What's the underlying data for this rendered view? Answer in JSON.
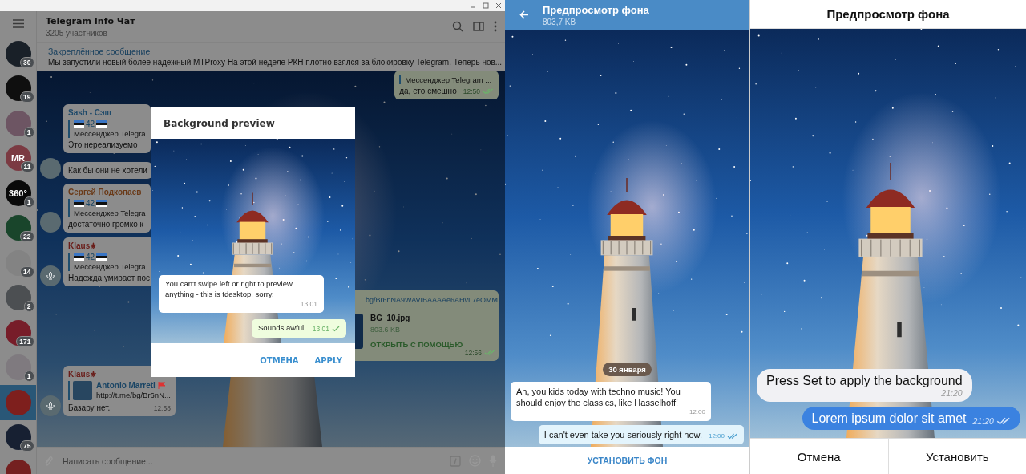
{
  "desktop": {
    "chat_list": [
      {
        "badge": "30",
        "color": "#192028",
        "selected": false
      },
      {
        "badge": "19",
        "color": "#0f0f0f",
        "selected": false
      },
      {
        "badge": "1",
        "color": "#6d5563",
        "selected": false
      },
      {
        "initials": "MR",
        "badge": "11",
        "color": "#7b3a42",
        "selected": false
      },
      {
        "initials": "360°",
        "badge": "1",
        "color": "#090909",
        "selected": false
      },
      {
        "badge": "22",
        "color": "#19452b",
        "selected": false
      },
      {
        "badge": "14",
        "color": "#838383",
        "selected": false
      },
      {
        "badge": "2",
        "color": "#4c4f52",
        "selected": false
      },
      {
        "badge": "171",
        "color": "#771d29",
        "selected": false
      },
      {
        "badge": "1",
        "color": "#7f7a7f",
        "selected": false
      },
      {
        "color": "#7e1f1d",
        "selected": true
      },
      {
        "badge": "75",
        "color": "#172032",
        "selected": false
      },
      {
        "color": "#742020",
        "selected": false
      }
    ],
    "chat_header": {
      "title": "Telegram Info Чат",
      "subtitle": "3205 участников"
    },
    "pinned_message": {
      "label": "Закреплённое сообщение",
      "text": "Мы запустили новый более надёжный MTProxy  На этой неделе РКН плотно взялся за блокировку Telegram. Теперь нов..."
    },
    "messages": [
      {
        "kind": "outgoing",
        "reply_text": "Мессенджер Telegram ...",
        "text": "да, ето смешно",
        "time": "12:50",
        "read": true
      },
      {
        "kind": "incoming",
        "sender": "Sash - Сэш",
        "color": "#1f4a6a",
        "reply_title": "42",
        "reply_text": "Мессенджер Telegra",
        "text": "Это нереализуемо",
        "avatar": false
      },
      {
        "kind": "incoming",
        "text": "Как бы они не хотели",
        "avatar": true
      },
      {
        "kind": "incoming",
        "sender": "Сергей Подкопаев",
        "color": "#6a3a18",
        "reply_title": "42",
        "reply_text": "Мессенджер Telegra",
        "text": "достаточно громко к",
        "avatar": true
      },
      {
        "kind": "incoming",
        "sender": "Klaus⚜",
        "color": "#6a1e1a",
        "reply_title": "42",
        "reply_text": "Мессенджер Telegra",
        "text": "Надежда умирает пос",
        "avatar": true
      },
      {
        "kind": "file",
        "link": "bg/Br6nNA9WAVIBAAAAe6AHvL7eOMM",
        "file_name": "BG_10.jpg",
        "file_size": "803.6 KB",
        "action": "ОТКРЫТЬ С ПОМОЩЬЮ",
        "time": "12:56",
        "read": true
      },
      {
        "kind": "link_preview",
        "sender": "Klaus⚜",
        "color": "#6a1e1a",
        "preview_title": "Antonio Marreti",
        "preview_text": "http://t.me/bg/Br6nN...",
        "text": "Базару нет.",
        "time": "12:58",
        "avatar": true
      }
    ],
    "composer": {
      "placeholder": "Написать сообщение..."
    },
    "dialog": {
      "title": "Background preview",
      "messages": [
        {
          "kind": "incoming",
          "text": "You can't swipe left or right to preview anything - this is tdesktop, sorry.",
          "time": "13:01"
        },
        {
          "kind": "outgoing",
          "text": "Sounds awful.",
          "time": "13:01",
          "read": false
        }
      ],
      "buttons": [
        "ОТМЕНА",
        "APPLY"
      ]
    }
  },
  "android_preview": {
    "title": "Предпросмотр фона",
    "subtitle": "803,7 KB",
    "date": "30 января",
    "messages": [
      {
        "kind": "incoming",
        "text": "Ah, you kids today with techno music! You should enjoy the classics, like Hasselhoff!",
        "time": "12:00"
      },
      {
        "kind": "outgoing",
        "text": "I can't even take you seriously right now.",
        "time": "12:00",
        "read": true
      }
    ],
    "button": "УСТАНОВИТЬ ФОН"
  },
  "ios_preview": {
    "title": "Предпросмотр фона",
    "messages": [
      {
        "kind": "incoming",
        "text": "Press Set to apply the background",
        "time": "21:20"
      },
      {
        "kind": "outgoing",
        "text": "Lorem ipsum dolor sit amet",
        "time": "21:20",
        "read": true
      }
    ],
    "buttons": [
      "Отмена",
      "Установить"
    ]
  }
}
